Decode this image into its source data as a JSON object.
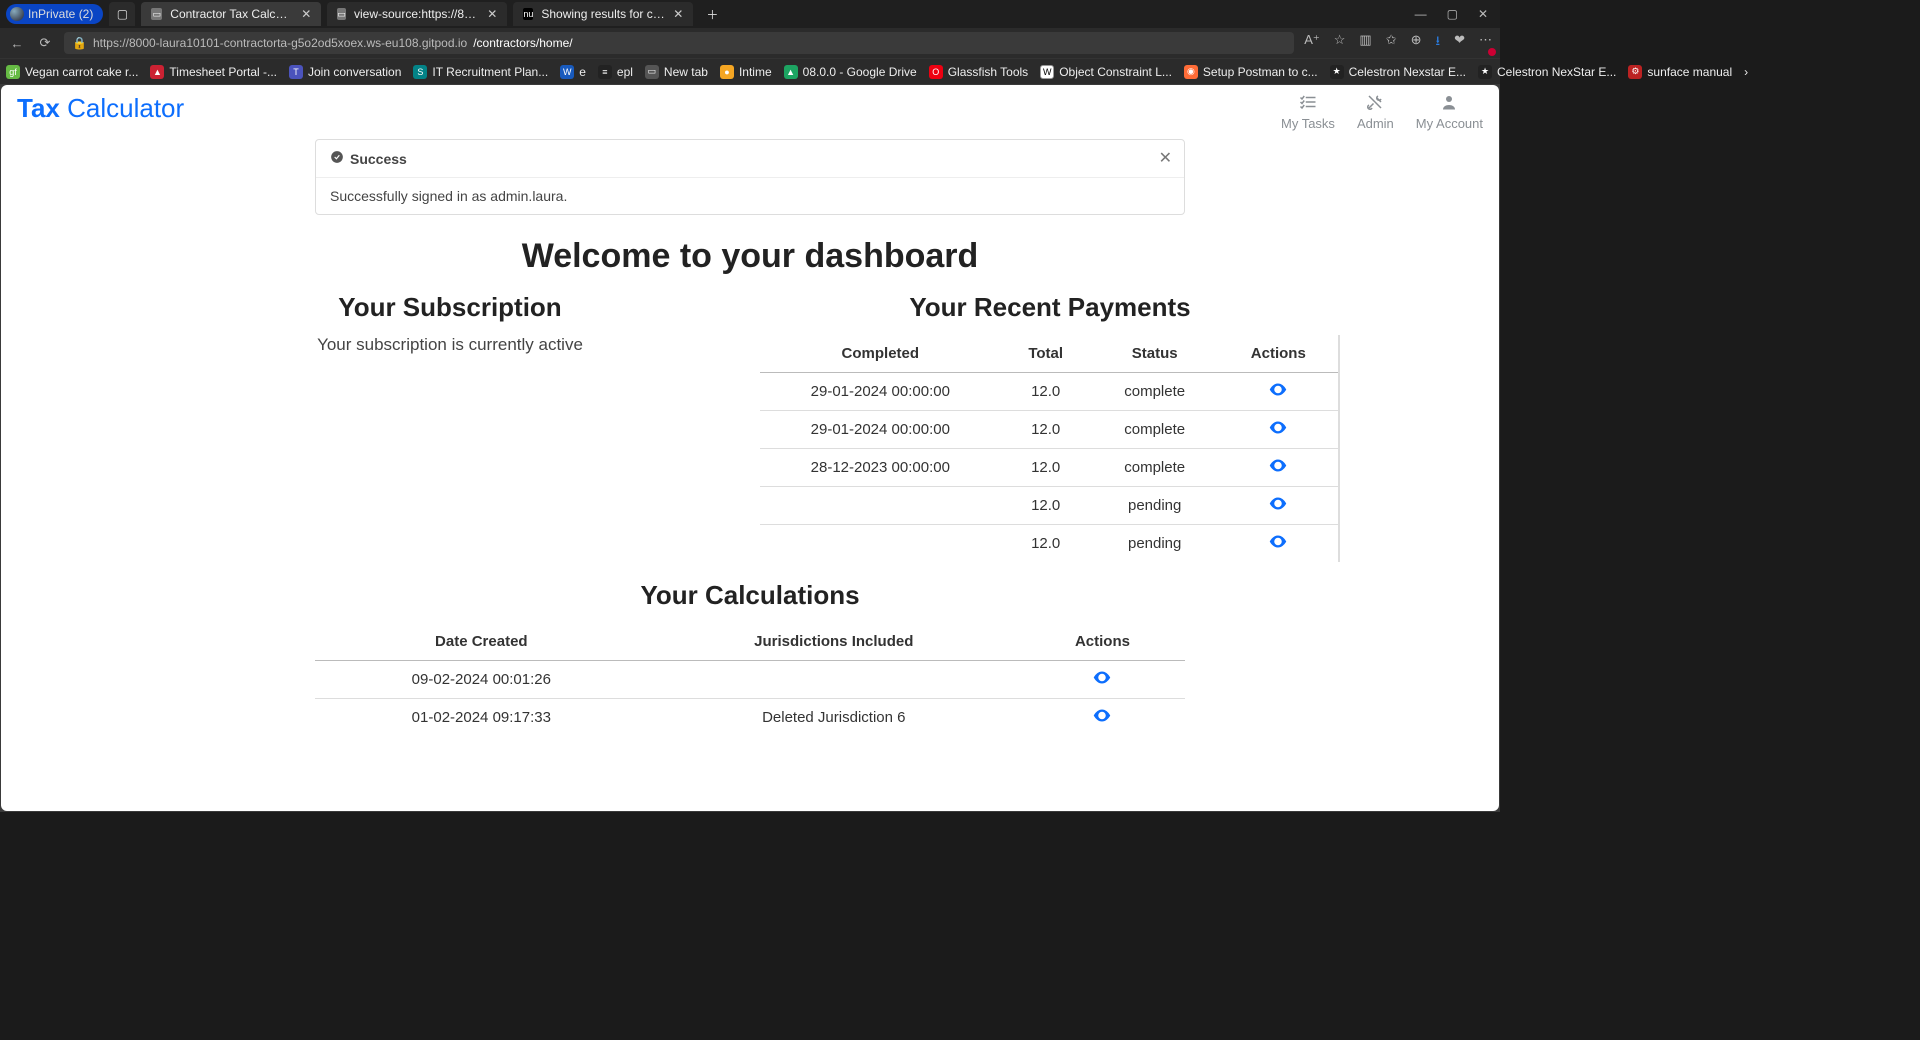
{
  "browser": {
    "private_label": "InPrivate (2)",
    "tabs": [
      {
        "label": "Contractor Tax Calculator"
      },
      {
        "label": "view-source:https://8000-laura10"
      },
      {
        "label": "Showing results for contents of t"
      }
    ],
    "url_host": "https://8000-laura10101-contractorta-g5o2od5xoex.ws-eu108.gitpod.io",
    "url_path": "/contractors/home/",
    "bookmarks": [
      "Vegan carrot cake r...",
      "Timesheet Portal -...",
      "Join conversation",
      "IT Recruitment Plan...",
      "e",
      "epl",
      "New tab",
      "Intime",
      "08.0.0 - Google Drive",
      "Glassfish Tools",
      "Object Constraint L...",
      "Setup Postman to c...",
      "Celestron Nexstar E...",
      "Celestron NexStar E...",
      "sunface manual"
    ]
  },
  "brand": {
    "first": "Tax",
    "second": "Calculator"
  },
  "nav": {
    "tasks": "My Tasks",
    "admin": "Admin",
    "account": "My Account"
  },
  "alert": {
    "title": "Success",
    "body": "Successfully signed in as admin.laura."
  },
  "headings": {
    "main": "Welcome to your dashboard",
    "sub_left": "Your Subscription",
    "sub_right": "Your Recent Payments",
    "calc": "Your Calculations"
  },
  "subscription_status": "Your subscription is currently active",
  "payments": {
    "headers": {
      "completed": "Completed",
      "total": "Total",
      "status": "Status",
      "actions": "Actions"
    },
    "rows": [
      {
        "completed": "29-01-2024 00:00:00",
        "total": "12.0",
        "status": "complete"
      },
      {
        "completed": "29-01-2024 00:00:00",
        "total": "12.0",
        "status": "complete"
      },
      {
        "completed": "28-12-2023 00:00:00",
        "total": "12.0",
        "status": "complete"
      },
      {
        "completed": "",
        "total": "12.0",
        "status": "pending"
      },
      {
        "completed": "",
        "total": "12.0",
        "status": "pending"
      }
    ]
  },
  "calculations": {
    "headers": {
      "date": "Date Created",
      "juris": "Jurisdictions Included",
      "actions": "Actions"
    },
    "rows": [
      {
        "date": "09-02-2024 00:01:26",
        "juris": ""
      },
      {
        "date": "01-02-2024 09:17:33",
        "juris": "Deleted Jurisdiction 6"
      }
    ]
  }
}
